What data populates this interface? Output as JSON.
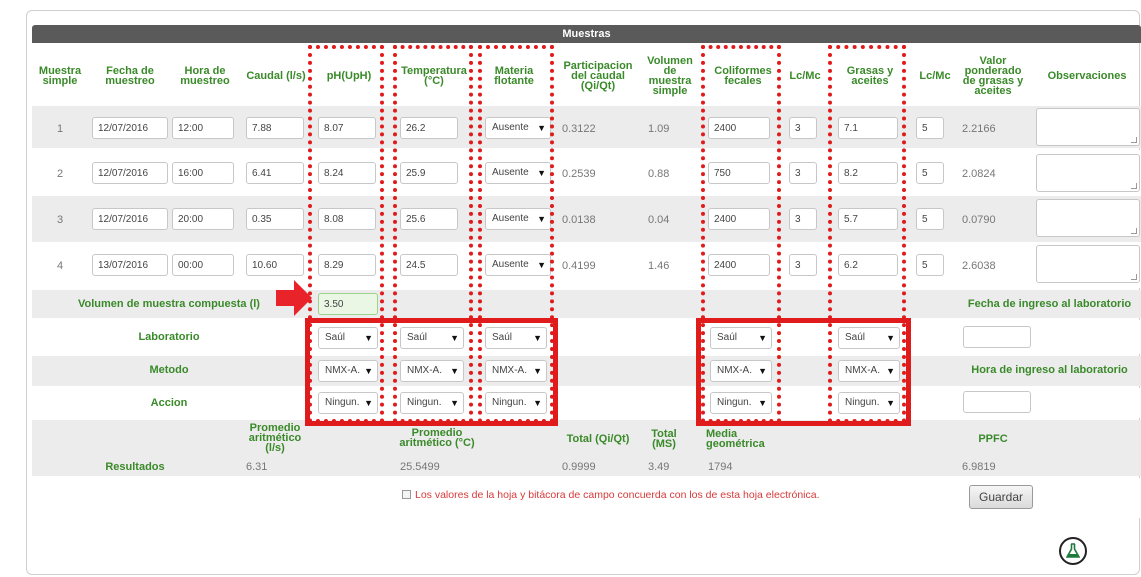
{
  "section_title": "Muestras",
  "columns": {
    "muestra": "Muestra simple",
    "fecha": "Fecha de muestreo",
    "hora": "Hora de muestreo",
    "caudal": "Caudal (l/s)",
    "ph": "pH(UpH)",
    "temp": "Temperatura (°C)",
    "materia": "Materia flotante",
    "participacion": "Participacion del caudal (Qi/Qt)",
    "volumen": "Volumen de muestra simple",
    "coliformes": "Coliformes fecales",
    "lcmc1": "Lc/Mc",
    "grasas": "Grasas y aceites",
    "lcmc2": "Lc/Mc",
    "valor": "Valor ponderado de grasas y aceites",
    "obs": "Observaciones"
  },
  "rows": [
    {
      "n": "1",
      "fecha": "12/07/2016",
      "hora": "12:00",
      "caudal": "7.88",
      "ph": "8.07",
      "temp": "26.2",
      "materia": "Ausente",
      "part": "0.3122",
      "vol": "1.09",
      "coli": "2400",
      "lc1": "3",
      "grasas": "7.1",
      "lc2": "5",
      "valor": "2.2166"
    },
    {
      "n": "2",
      "fecha": "12/07/2016",
      "hora": "16:00",
      "caudal": "6.41",
      "ph": "8.24",
      "temp": "25.9",
      "materia": "Ausente",
      "part": "0.2539",
      "vol": "0.88",
      "coli": "750",
      "lc1": "3",
      "grasas": "8.2",
      "lc2": "5",
      "valor": "2.0824"
    },
    {
      "n": "3",
      "fecha": "12/07/2016",
      "hora": "20:00",
      "caudal": "0.35",
      "ph": "8.08",
      "temp": "25.6",
      "materia": "Ausente",
      "part": "0.0138",
      "vol": "0.04",
      "coli": "2400",
      "lc1": "3",
      "grasas": "5.7",
      "lc2": "5",
      "valor": "0.0790"
    },
    {
      "n": "4",
      "fecha": "13/07/2016",
      "hora": "00:00",
      "caudal": "10.60",
      "ph": "8.29",
      "temp": "24.5",
      "materia": "Ausente",
      "part": "0.4199",
      "vol": "1.46",
      "coli": "2400",
      "lc1": "3",
      "grasas": "6.2",
      "lc2": "5",
      "valor": "2.6038"
    }
  ],
  "compuesta": {
    "label": "Volumen de muestra compuesta (l)",
    "value": "3.50"
  },
  "fecha_ingreso_label": "Fecha de ingreso al laboratorio",
  "hora_ingreso_label": "Hora de ingreso al laboratorio",
  "laboratorio": {
    "label": "Laboratorio",
    "value": "Saúl"
  },
  "metodo": {
    "label": "Metodo",
    "value": "NMX-A."
  },
  "accion": {
    "label": "Accion",
    "value": "Ningun."
  },
  "resultados": {
    "label": "Resultados",
    "prom_caudal_label": "Promedio aritmético (l/s)",
    "prom_caudal": "6.31",
    "prom_temp_label": "Promedio aritmético (°C)",
    "prom_temp": "25.5499",
    "total_q_label": "Total (Qi/Qt)",
    "total_q": "0.9999",
    "total_ms_label": "Total (MS)",
    "total_ms": "3.49",
    "media_label": "Media geométrica",
    "media": "1794",
    "ppfc_label": "PPFC",
    "ppfc": "6.9819"
  },
  "notice": "Los valores de la hoja y bitácora de campo concuerda con los de esta hoja electrónica.",
  "save_label": "Guardar",
  "colors": {
    "green": "#3a8a2a",
    "red": "#e01b1b",
    "header": "#5a5a5a"
  },
  "icons": {
    "flask": "flask-icon",
    "arrow": "red-arrow"
  }
}
